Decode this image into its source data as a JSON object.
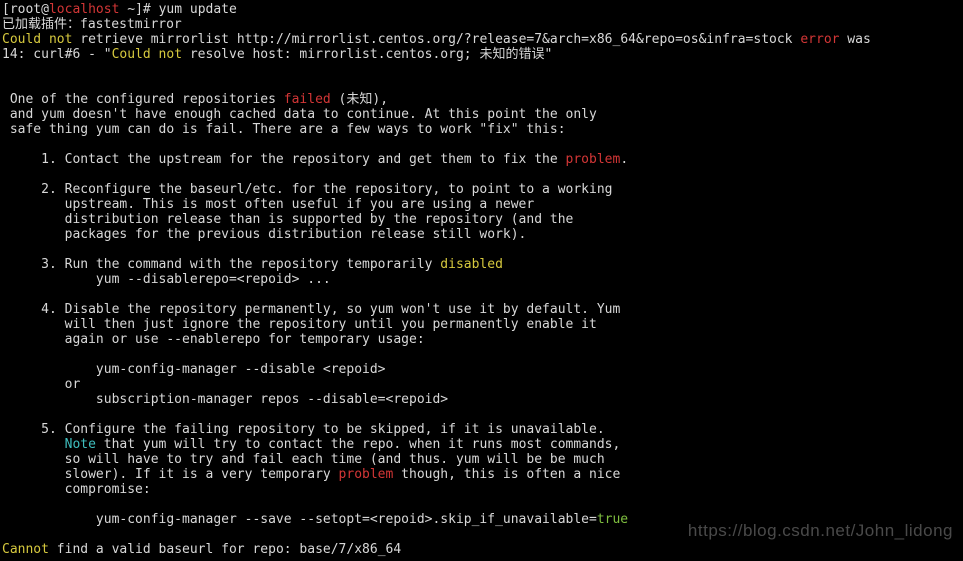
{
  "colors": {
    "white": "#d8d8d8",
    "red": "#d33636",
    "yellow": "#d6c93e",
    "green": "#7fbf3f",
    "cyan": "#3fbfbf"
  },
  "prompt": {
    "l": "[root@",
    "host": "localhost",
    "r": " ~]# ",
    "cmd": "yum update"
  },
  "l2": "已加载插件：fastestmirror",
  "l3": {
    "a": "Could not",
    "b": " retrieve mirrorlist http://mirrorlist.centos.org/?release=7&arch=x86_64&repo=os&infra=stock ",
    "c": "error",
    "d": " was"
  },
  "l4": {
    "a": "14: curl#6 - \"",
    "b": "Could not",
    "c": " resolve host: mirrorlist.centos.org; 未知的错误",
    "d": "\""
  },
  "l7": {
    "a": " One of the configured repositories ",
    "b": "failed",
    "c": " (未知),"
  },
  "l8": " and yum doesn't have enough cached data to continue. At this point the only",
  "l9": " safe thing yum can do is fail. There are a few ways to work \"fix\" this:",
  "l11": {
    "a": "     1. Contact the upstream for the repository and get them to fix the ",
    "b": "problem",
    "c": "."
  },
  "l13": "     2. Reconfigure the baseurl/etc. for the repository, to point to a working",
  "l14": "        upstream. This is most often useful if you are using a newer",
  "l15": "        distribution release than is supported by the repository (and the",
  "l16": "        packages for the previous distribution release still work).",
  "l18": {
    "a": "     3. Run the command with the repository temporarily ",
    "b": "disabled"
  },
  "l19": "            yum --disablerepo=<repoid> ...",
  "l21": "     4. Disable the repository permanently, so yum won't use it by default. Yum",
  "l22": "        will then just ignore the repository until you permanently enable it",
  "l23": "        again or use --enablerepo for temporary usage:",
  "l25": "            yum-config-manager --disable <repoid>",
  "l26": "        or",
  "l27": "            subscription-manager repos --disable=<repoid>",
  "l29": "     5. Configure the failing repository to be skipped, if it is unavailable.",
  "l30a": "        ",
  "l30b": "Note",
  "l30c": " that yum will try to contact the repo. when it runs most commands,",
  "l31": "        so will have to try and fail each time (and thus. yum will be be much",
  "l32a": "        slower). If it is a very temporary ",
  "l32b": "problem",
  "l32c": " though, this is often a nice",
  "l33": "        compromise:",
  "l35a": "            yum-config-manager --save --setopt=<repoid>.skip_if_unavailable=",
  "l35b": "true",
  "l37a": "Cannot",
  "l37b": " find a valid baseurl for repo: base/7/x86_64",
  "watermark": "https://blog.csdn.net/John_lidong"
}
